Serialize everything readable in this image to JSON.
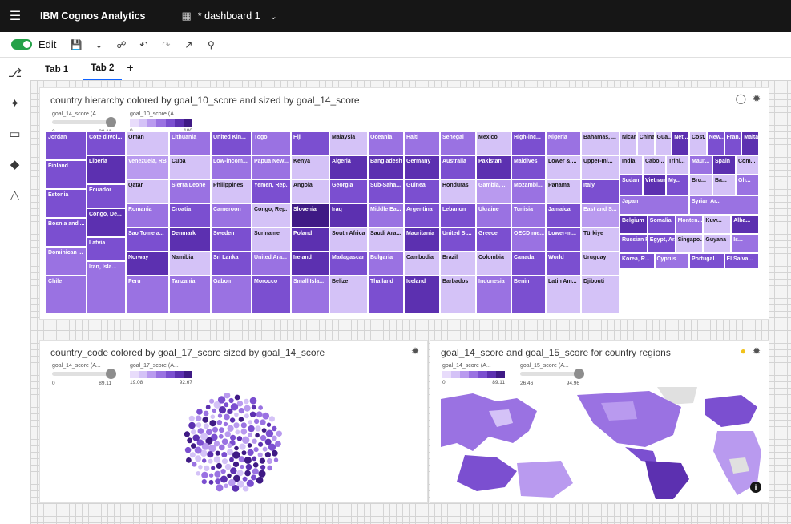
{
  "app": {
    "title": "IBM Cognos Analytics",
    "dashboard_name": "* dashboard 1"
  },
  "toolbar": {
    "edit_label": "Edit"
  },
  "tabs": [
    {
      "label": "Tab 1"
    },
    {
      "label": "Tab 2"
    }
  ],
  "tab_add": "+",
  "widget1": {
    "title": "country hierarchy colored by goal_10_score and sized by goal_14_score",
    "legend_size": {
      "title": "goal_14_score (A...",
      "min": "0",
      "max": "89.11"
    },
    "legend_color": {
      "title": "goal_10_score (A...",
      "min": "0",
      "max": "100"
    },
    "colors": [
      "#e8dcfb",
      "#d4c2f7",
      "#b99aef",
      "#9a72e2",
      "#7b4fd0",
      "#5c30b0",
      "#3f1a85"
    ]
  },
  "widget2": {
    "title": "country_code colored by goal_17_score sized by goal_14_score",
    "legend_size": {
      "title": "goal_14_score (A...",
      "min": "0",
      "max": "89.11"
    },
    "legend_color": {
      "title": "goal_17_score (A...",
      "min": "19.08",
      "max": "92.67"
    }
  },
  "widget3": {
    "title": "goal_14_score and goal_15_score for country regions",
    "legend_color": {
      "title": "goal_14_score (A...",
      "min": "0",
      "max": "89.11"
    },
    "legend_size": {
      "title": "goal_15_score (A...",
      "min": "26.46",
      "max": "94.96"
    }
  },
  "treemap_cells": [
    {
      "label": "Jordan",
      "c": 4
    },
    {
      "label": "Finland",
      "c": 4
    },
    {
      "label": "Estonia",
      "c": 4
    },
    {
      "label": "Bosnia and ...",
      "c": 4
    },
    {
      "label": "Dominican ...",
      "c": 3
    },
    {
      "label": "Chile",
      "c": 3
    },
    {
      "label": "Cote d'Ivoi...",
      "c": 4
    },
    {
      "label": "Liberia",
      "c": 5
    },
    {
      "label": "Ecuador",
      "c": 4
    },
    {
      "label": "Congo, De...",
      "c": 5
    },
    {
      "label": "Latvia",
      "c": 4
    },
    {
      "label": "Iran, Isla...",
      "c": 3
    },
    {
      "label": "Oman",
      "c": 1
    },
    {
      "label": "Venezuela, RB",
      "c": 2
    },
    {
      "label": "Qatar",
      "c": 1
    },
    {
      "label": "Romania",
      "c": 3
    },
    {
      "label": "Sao Tome a...",
      "c": 4
    },
    {
      "label": "Norway",
      "c": 5
    },
    {
      "label": "Peru",
      "c": 3
    },
    {
      "label": "Lithuania",
      "c": 3
    },
    {
      "label": "Cuba",
      "c": 1
    },
    {
      "label": "Sierra Leone",
      "c": 3
    },
    {
      "label": "Croatia",
      "c": 4
    },
    {
      "label": "Denmark",
      "c": 5
    },
    {
      "label": "Namibia",
      "c": 1
    },
    {
      "label": "Tanzania",
      "c": 3
    },
    {
      "label": "United Kin...",
      "c": 4
    },
    {
      "label": "Low-incom...",
      "c": 3
    },
    {
      "label": "Philippines",
      "c": 1
    },
    {
      "label": "Cameroon",
      "c": 3
    },
    {
      "label": "Sweden",
      "c": 4
    },
    {
      "label": "Sri Lanka",
      "c": 4
    },
    {
      "label": "Gabon",
      "c": 3
    },
    {
      "label": "Togo",
      "c": 3
    },
    {
      "label": "Papua New...",
      "c": 3
    },
    {
      "label": "Yemen, Rep.",
      "c": 4
    },
    {
      "label": "Congo, Rep.",
      "c": 1
    },
    {
      "label": "Suriname",
      "c": 1
    },
    {
      "label": "United Ara...",
      "c": 3
    },
    {
      "label": "Morocco",
      "c": 4
    },
    {
      "label": "Fiji",
      "c": 4
    },
    {
      "label": "Kenya",
      "c": 1
    },
    {
      "label": "Angola",
      "c": 1
    },
    {
      "label": "Slovenia",
      "c": 6
    },
    {
      "label": "Poland",
      "c": 5
    },
    {
      "label": "Ireland",
      "c": 5
    },
    {
      "label": "Small Isla...",
      "c": 3
    },
    {
      "label": "Malaysia",
      "c": 1
    },
    {
      "label": "Algeria",
      "c": 5
    },
    {
      "label": "Georgia",
      "c": 4
    },
    {
      "label": "Iraq",
      "c": 5
    },
    {
      "label": "South Africa",
      "c": 1
    },
    {
      "label": "Madagascar",
      "c": 4
    },
    {
      "label": "Belize",
      "c": 1
    },
    {
      "label": "Oceania",
      "c": 3
    },
    {
      "label": "Bangladesh",
      "c": 5
    },
    {
      "label": "Sub-Saha...",
      "c": 4
    },
    {
      "label": "Middle Ea...",
      "c": 3
    },
    {
      "label": "Saudi Ara...",
      "c": 1
    },
    {
      "label": "Bulgaria",
      "c": 3
    },
    {
      "label": "Thailand",
      "c": 4
    },
    {
      "label": "Haiti",
      "c": 3
    },
    {
      "label": "Germany",
      "c": 5
    },
    {
      "label": "Guinea",
      "c": 4
    },
    {
      "label": "Argentina",
      "c": 4
    },
    {
      "label": "Mauritania",
      "c": 5
    },
    {
      "label": "Cambodia",
      "c": 1
    },
    {
      "label": "Iceland",
      "c": 5
    },
    {
      "label": "Senegal",
      "c": 3
    },
    {
      "label": "Australia",
      "c": 4
    },
    {
      "label": "Honduras",
      "c": 1
    },
    {
      "label": "Lebanon",
      "c": 4
    },
    {
      "label": "United St...",
      "c": 4
    },
    {
      "label": "Brazil",
      "c": 1
    },
    {
      "label": "Barbados",
      "c": 1
    },
    {
      "label": "Mexico",
      "c": 1
    },
    {
      "label": "Pakistan",
      "c": 5
    },
    {
      "label": "Gambia, ...",
      "c": 2
    },
    {
      "label": "Ukraine",
      "c": 3
    },
    {
      "label": "Greece",
      "c": 4
    },
    {
      "label": "Colombia",
      "c": 1
    },
    {
      "label": "Indonesia",
      "c": 3
    },
    {
      "label": "High-inc...",
      "c": 4
    },
    {
      "label": "Maldives",
      "c": 4
    },
    {
      "label": "Mozambi...",
      "c": 3
    },
    {
      "label": "Tunisia",
      "c": 3
    },
    {
      "label": "OECD me...",
      "c": 3
    },
    {
      "label": "Canada",
      "c": 4
    },
    {
      "label": "Benin",
      "c": 4
    },
    {
      "label": "Nigeria",
      "c": 3
    },
    {
      "label": "Lower & ...",
      "c": 1
    },
    {
      "label": "Panama",
      "c": 1
    },
    {
      "label": "Jamaica",
      "c": 4
    },
    {
      "label": "Lower-m...",
      "c": 4
    },
    {
      "label": "World",
      "c": 4
    },
    {
      "label": "Latin Am...",
      "c": 1
    },
    {
      "label": "Bahamas, ...",
      "c": 1
    },
    {
      "label": "Upper-mi...",
      "c": 1
    },
    {
      "label": "Italy",
      "c": 4
    },
    {
      "label": "East and S...",
      "c": 2
    },
    {
      "label": "Türkiye",
      "c": 1
    },
    {
      "label": "Uruguay",
      "c": 1
    },
    {
      "label": "Djibouti",
      "c": 1
    },
    {
      "label": "Nicaragua",
      "c": 1
    },
    {
      "label": "China",
      "c": 1
    },
    {
      "label": "Gua...",
      "c": 1
    },
    {
      "label": "Net...",
      "c": 5
    },
    {
      "label": "Cost...",
      "c": 1
    },
    {
      "label": "New...",
      "c": 4
    },
    {
      "label": "Fran...",
      "c": 4
    },
    {
      "label": "Malta",
      "c": 5
    },
    {
      "label": "India",
      "c": 1
    },
    {
      "label": "Cabo...",
      "c": 1
    },
    {
      "label": "Trini...",
      "c": 1
    },
    {
      "label": "Maur...",
      "c": 3
    },
    {
      "label": "Spain",
      "c": 5
    },
    {
      "label": "Com...",
      "c": 1
    },
    {
      "label": "Sudan",
      "c": 4
    },
    {
      "label": "Vietnam",
      "c": 5
    },
    {
      "label": "My...",
      "c": 4
    },
    {
      "label": "Bru...",
      "c": 1
    },
    {
      "label": "Ba...",
      "c": 1
    },
    {
      "label": "Gh...",
      "c": 3
    },
    {
      "label": "Japan",
      "c": 3
    },
    {
      "label": "Syrian Ar...",
      "c": 3
    },
    {
      "label": "Belgium",
      "c": 5
    },
    {
      "label": "Somalia",
      "c": 4
    },
    {
      "label": "Monten...",
      "c": 3
    },
    {
      "label": "Kuw...",
      "c": 1
    },
    {
      "label": "Alba...",
      "c": 5
    },
    {
      "label": "Russian F...",
      "c": 4
    },
    {
      "label": "Egypt, Ar...",
      "c": 4
    },
    {
      "label": "Singapo...",
      "c": 1
    },
    {
      "label": "Guyana",
      "c": 1
    },
    {
      "label": "Is...",
      "c": 3
    },
    {
      "label": "Korea, R...",
      "c": 4
    },
    {
      "label": "Cyprus",
      "c": 3
    },
    {
      "label": "Portugal",
      "c": 4
    },
    {
      "label": "El Salva...",
      "c": 4
    }
  ]
}
